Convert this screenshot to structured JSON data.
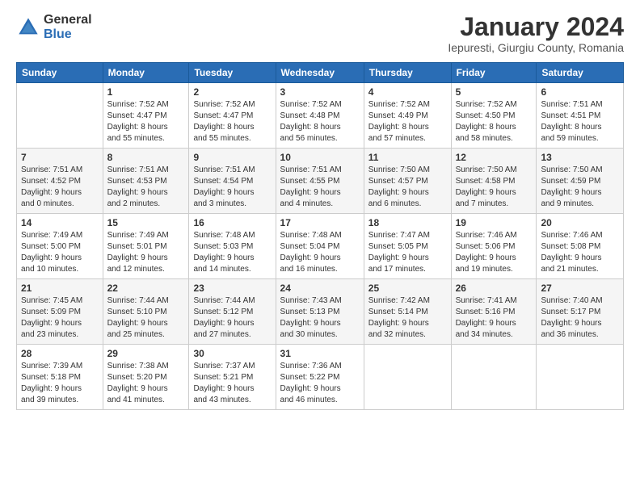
{
  "header": {
    "logo_general": "General",
    "logo_blue": "Blue",
    "title": "January 2024",
    "location": "Iepuresti, Giurgiu County, Romania"
  },
  "calendar": {
    "days_of_week": [
      "Sunday",
      "Monday",
      "Tuesday",
      "Wednesday",
      "Thursday",
      "Friday",
      "Saturday"
    ],
    "weeks": [
      [
        {
          "day": "",
          "info": ""
        },
        {
          "day": "1",
          "info": "Sunrise: 7:52 AM\nSunset: 4:47 PM\nDaylight: 8 hours\nand 55 minutes."
        },
        {
          "day": "2",
          "info": "Sunrise: 7:52 AM\nSunset: 4:47 PM\nDaylight: 8 hours\nand 55 minutes."
        },
        {
          "day": "3",
          "info": "Sunrise: 7:52 AM\nSunset: 4:48 PM\nDaylight: 8 hours\nand 56 minutes."
        },
        {
          "day": "4",
          "info": "Sunrise: 7:52 AM\nSunset: 4:49 PM\nDaylight: 8 hours\nand 57 minutes."
        },
        {
          "day": "5",
          "info": "Sunrise: 7:52 AM\nSunset: 4:50 PM\nDaylight: 8 hours\nand 58 minutes."
        },
        {
          "day": "6",
          "info": "Sunrise: 7:51 AM\nSunset: 4:51 PM\nDaylight: 8 hours\nand 59 minutes."
        }
      ],
      [
        {
          "day": "7",
          "info": "Sunrise: 7:51 AM\nSunset: 4:52 PM\nDaylight: 9 hours\nand 0 minutes."
        },
        {
          "day": "8",
          "info": "Sunrise: 7:51 AM\nSunset: 4:53 PM\nDaylight: 9 hours\nand 2 minutes."
        },
        {
          "day": "9",
          "info": "Sunrise: 7:51 AM\nSunset: 4:54 PM\nDaylight: 9 hours\nand 3 minutes."
        },
        {
          "day": "10",
          "info": "Sunrise: 7:51 AM\nSunset: 4:55 PM\nDaylight: 9 hours\nand 4 minutes."
        },
        {
          "day": "11",
          "info": "Sunrise: 7:50 AM\nSunset: 4:57 PM\nDaylight: 9 hours\nand 6 minutes."
        },
        {
          "day": "12",
          "info": "Sunrise: 7:50 AM\nSunset: 4:58 PM\nDaylight: 9 hours\nand 7 minutes."
        },
        {
          "day": "13",
          "info": "Sunrise: 7:50 AM\nSunset: 4:59 PM\nDaylight: 9 hours\nand 9 minutes."
        }
      ],
      [
        {
          "day": "14",
          "info": "Sunrise: 7:49 AM\nSunset: 5:00 PM\nDaylight: 9 hours\nand 10 minutes."
        },
        {
          "day": "15",
          "info": "Sunrise: 7:49 AM\nSunset: 5:01 PM\nDaylight: 9 hours\nand 12 minutes."
        },
        {
          "day": "16",
          "info": "Sunrise: 7:48 AM\nSunset: 5:03 PM\nDaylight: 9 hours\nand 14 minutes."
        },
        {
          "day": "17",
          "info": "Sunrise: 7:48 AM\nSunset: 5:04 PM\nDaylight: 9 hours\nand 16 minutes."
        },
        {
          "day": "18",
          "info": "Sunrise: 7:47 AM\nSunset: 5:05 PM\nDaylight: 9 hours\nand 17 minutes."
        },
        {
          "day": "19",
          "info": "Sunrise: 7:46 AM\nSunset: 5:06 PM\nDaylight: 9 hours\nand 19 minutes."
        },
        {
          "day": "20",
          "info": "Sunrise: 7:46 AM\nSunset: 5:08 PM\nDaylight: 9 hours\nand 21 minutes."
        }
      ],
      [
        {
          "day": "21",
          "info": "Sunrise: 7:45 AM\nSunset: 5:09 PM\nDaylight: 9 hours\nand 23 minutes."
        },
        {
          "day": "22",
          "info": "Sunrise: 7:44 AM\nSunset: 5:10 PM\nDaylight: 9 hours\nand 25 minutes."
        },
        {
          "day": "23",
          "info": "Sunrise: 7:44 AM\nSunset: 5:12 PM\nDaylight: 9 hours\nand 27 minutes."
        },
        {
          "day": "24",
          "info": "Sunrise: 7:43 AM\nSunset: 5:13 PM\nDaylight: 9 hours\nand 30 minutes."
        },
        {
          "day": "25",
          "info": "Sunrise: 7:42 AM\nSunset: 5:14 PM\nDaylight: 9 hours\nand 32 minutes."
        },
        {
          "day": "26",
          "info": "Sunrise: 7:41 AM\nSunset: 5:16 PM\nDaylight: 9 hours\nand 34 minutes."
        },
        {
          "day": "27",
          "info": "Sunrise: 7:40 AM\nSunset: 5:17 PM\nDaylight: 9 hours\nand 36 minutes."
        }
      ],
      [
        {
          "day": "28",
          "info": "Sunrise: 7:39 AM\nSunset: 5:18 PM\nDaylight: 9 hours\nand 39 minutes."
        },
        {
          "day": "29",
          "info": "Sunrise: 7:38 AM\nSunset: 5:20 PM\nDaylight: 9 hours\nand 41 minutes."
        },
        {
          "day": "30",
          "info": "Sunrise: 7:37 AM\nSunset: 5:21 PM\nDaylight: 9 hours\nand 43 minutes."
        },
        {
          "day": "31",
          "info": "Sunrise: 7:36 AM\nSunset: 5:22 PM\nDaylight: 9 hours\nand 46 minutes."
        },
        {
          "day": "",
          "info": ""
        },
        {
          "day": "",
          "info": ""
        },
        {
          "day": "",
          "info": ""
        }
      ]
    ]
  }
}
